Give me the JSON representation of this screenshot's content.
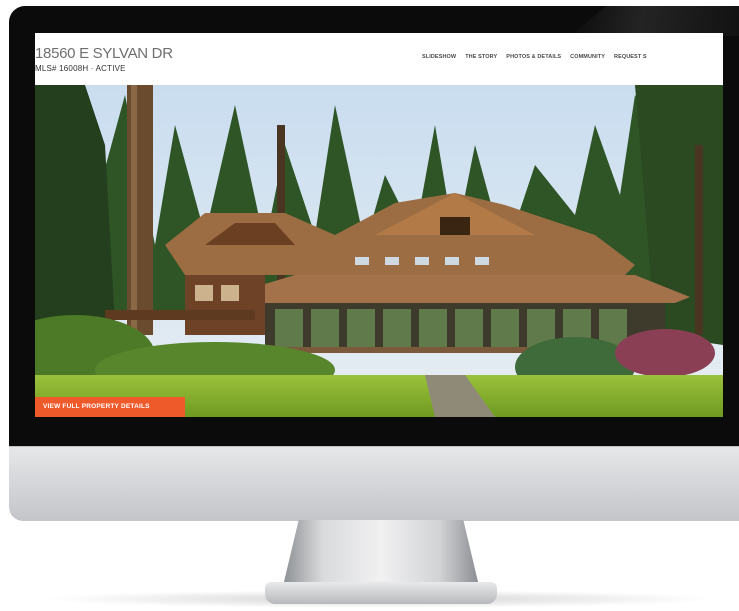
{
  "listing": {
    "address": "18560 E SYLVAN DR",
    "mls": "MLS# 16008H · ACTIVE"
  },
  "nav": {
    "items": [
      {
        "label": "SLIDESHOW"
      },
      {
        "label": "THE STORY"
      },
      {
        "label": "PHOTOS & DETAILS"
      },
      {
        "label": "COMMUNITY"
      },
      {
        "label": "REQUEST S"
      }
    ]
  },
  "hero": {
    "cta_label": "VIEW FULL PROPERTY DETAILS",
    "cta_color": "#ef5a2b"
  }
}
